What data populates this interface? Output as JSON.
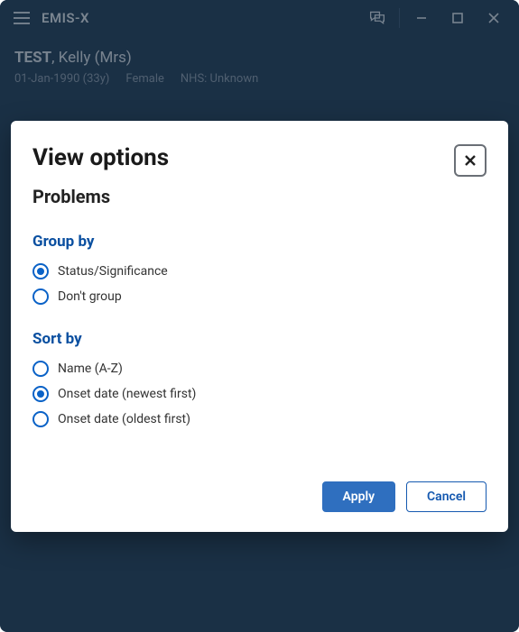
{
  "app": {
    "name": "EMIS-X"
  },
  "patient": {
    "surname": "TEST",
    "rest": ", Kelly (Mrs)",
    "dob": "01-Jan-1990 (33y)",
    "gender": "Female",
    "nhs": "NHS: Unknown"
  },
  "dialog": {
    "title": "View options",
    "subtitle": "Problems",
    "group_by": {
      "title": "Group by",
      "options": [
        {
          "label": "Status/Significance",
          "checked": true
        },
        {
          "label": "Don't group",
          "checked": false
        }
      ]
    },
    "sort_by": {
      "title": "Sort by",
      "options": [
        {
          "label": "Name (A-Z)",
          "checked": false
        },
        {
          "label": "Onset date (newest first)",
          "checked": true
        },
        {
          "label": "Onset date (oldest first)",
          "checked": false
        }
      ]
    },
    "apply": "Apply",
    "cancel": "Cancel"
  }
}
